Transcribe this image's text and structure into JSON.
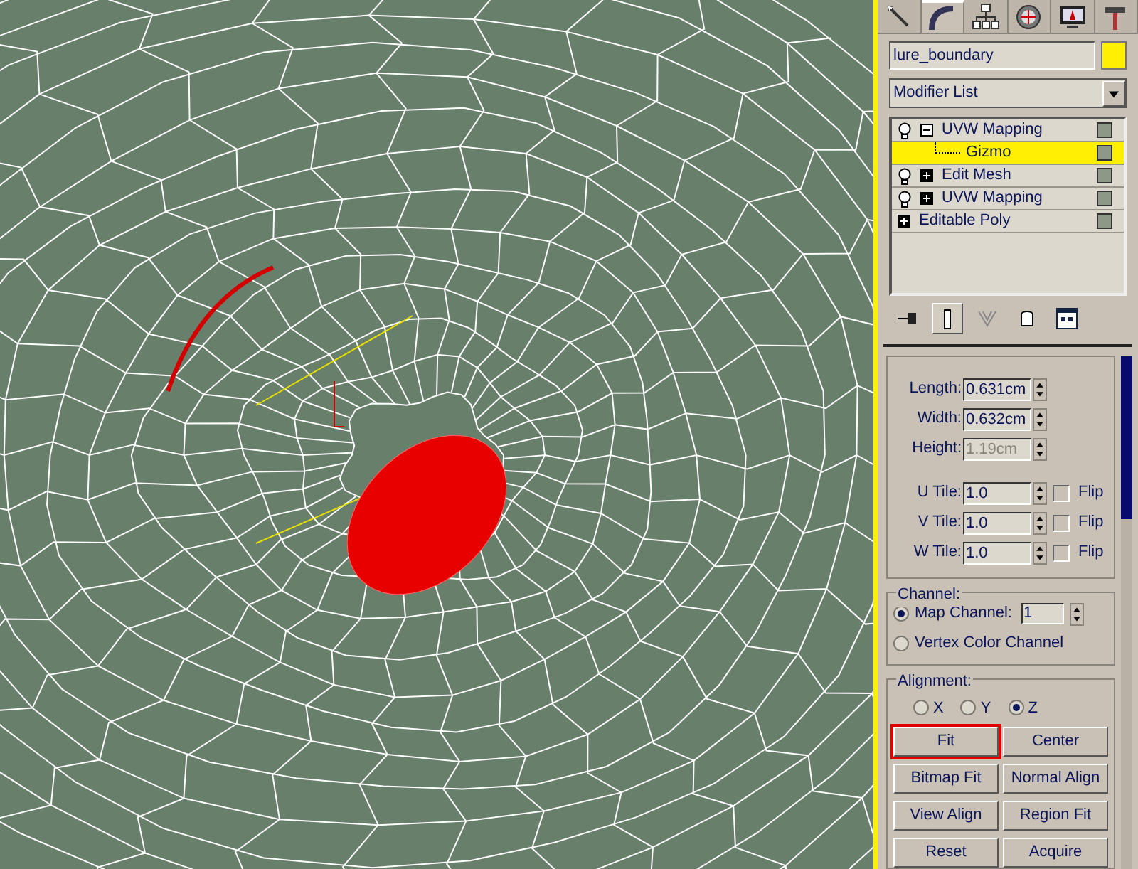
{
  "command_tabs": [
    {
      "kind": "create",
      "selected": false
    },
    {
      "kind": "modify",
      "selected": true
    },
    {
      "kind": "hierarchy",
      "selected": false
    },
    {
      "kind": "motion",
      "selected": false
    },
    {
      "kind": "display",
      "selected": false
    },
    {
      "kind": "utilities",
      "selected": false
    }
  ],
  "object": {
    "name": "lure_boundary",
    "color": "#ffef00"
  },
  "modifier_list": {
    "value": "Modifier List"
  },
  "stack": [
    {
      "label": "UVW Mapping",
      "bulb": true,
      "expanded": true,
      "selected": false,
      "children": [
        {
          "label": "Gizmo",
          "selected": true
        }
      ]
    },
    {
      "label": "Edit Mesh",
      "bulb": true,
      "expanded": false,
      "selected": false
    },
    {
      "label": "UVW Mapping",
      "bulb": true,
      "expanded": false,
      "selected": false
    },
    {
      "label": "Editable Poly",
      "bulb": false,
      "expanded": false,
      "selected": false
    }
  ],
  "stack_toolbar": [
    {
      "kind": "pin",
      "pressed": false
    },
    {
      "kind": "end-result",
      "pressed": true
    },
    {
      "kind": "unique",
      "pressed": false
    },
    {
      "kind": "remove",
      "pressed": false
    },
    {
      "kind": "configure",
      "pressed": false
    }
  ],
  "parameters": {
    "sizes": [
      {
        "label": "Length:",
        "value": "0.631cm",
        "disabled": false
      },
      {
        "label": "Width:",
        "value": "0.632cm",
        "disabled": false
      },
      {
        "label": "Height:",
        "value": "1.19cm",
        "disabled": true
      }
    ],
    "tiles": [
      {
        "label": "U Tile:",
        "value": "1.0",
        "flip_label": "Flip",
        "flip": false
      },
      {
        "label": "V Tile:",
        "value": "1.0",
        "flip_label": "Flip",
        "flip": false
      },
      {
        "label": "W Tile:",
        "value": "1.0",
        "flip_label": "Flip",
        "flip": false
      }
    ]
  },
  "channel": {
    "title": "Channel:",
    "options": [
      {
        "label": "Map Channel:",
        "selected": true,
        "value": "1"
      },
      {
        "label": "Vertex Color Channel",
        "selected": false
      }
    ]
  },
  "alignment": {
    "title": "Alignment:",
    "axes": [
      {
        "label": "X",
        "selected": false
      },
      {
        "label": "Y",
        "selected": false
      },
      {
        "label": "Z",
        "selected": true
      }
    ],
    "buttons": [
      {
        "label": "Fit",
        "highlighted": true
      },
      {
        "label": "Center",
        "highlighted": false
      },
      {
        "label": "Bitmap Fit",
        "highlighted": false
      },
      {
        "label": "Normal Align",
        "highlighted": false
      },
      {
        "label": "View Align",
        "highlighted": false
      },
      {
        "label": "Region Fit",
        "highlighted": false
      },
      {
        "label": "Reset",
        "highlighted": false
      },
      {
        "label": "Acquire",
        "highlighted": false
      }
    ]
  }
}
